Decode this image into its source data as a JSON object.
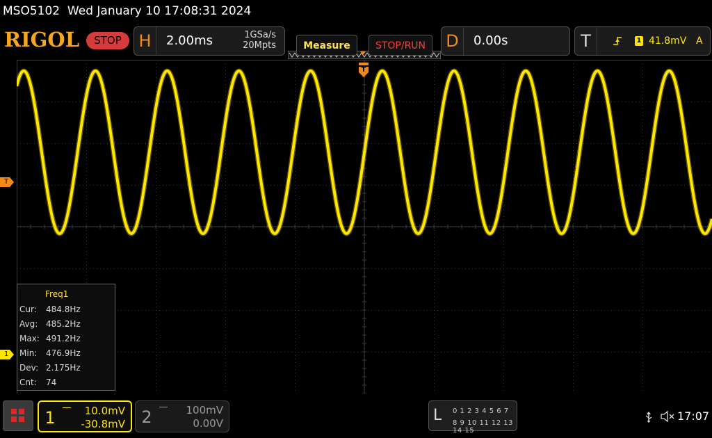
{
  "status": {
    "model": "MSO5102",
    "datetime": "Wed January 10 17:08:31 2024"
  },
  "brand": {
    "logo": "RIGOL",
    "run_state": "STOP"
  },
  "horizontal": {
    "letter": "H",
    "timebase": "2.00ms",
    "sample_rate": "1GSa/s",
    "memory_depth": "20Mpts"
  },
  "buttons": {
    "measure": "Measure",
    "stop_run": "STOP/RUN"
  },
  "delay": {
    "letter": "D",
    "value": "0.00s"
  },
  "trigger": {
    "letter": "T",
    "source": "1",
    "level": "41.8mV",
    "mode": "A"
  },
  "markers": {
    "trigger_level": "T",
    "ch1": "1",
    "trigger_position": "T"
  },
  "measure_panel": {
    "title": "Freq1",
    "rows": [
      {
        "label": "Cur:",
        "value": "484.8Hz"
      },
      {
        "label": "Avg:",
        "value": "485.2Hz"
      },
      {
        "label": "Max:",
        "value": "491.2Hz"
      },
      {
        "label": "Min:",
        "value": "476.9Hz"
      },
      {
        "label": "Dev:",
        "value": "2.175Hz"
      },
      {
        "label": "Cnt:",
        "value": "74"
      }
    ]
  },
  "channels": [
    {
      "number": "1",
      "scale": "10.0mV",
      "offset": "-30.8mV",
      "color": "#ffe600"
    },
    {
      "number": "2",
      "scale": "100mV",
      "offset": "0.00V",
      "color": "#8a8a8a"
    }
  ],
  "logic": {
    "letter": "L",
    "row1": "0 1 2 3  4 5 6 7",
    "row2": "8 9 10 11 12 13 14 15"
  },
  "system": {
    "time": "17:07"
  },
  "icons": [
    "home-menu-icon",
    "usb-icon",
    "speaker-muted-icon",
    "trigger-rising-edge-icon"
  ],
  "colors": {
    "trace": "#ffe600",
    "accent": "#f28a1a",
    "stop": "#d63c3c",
    "graticule": "#3c3c3c"
  }
}
